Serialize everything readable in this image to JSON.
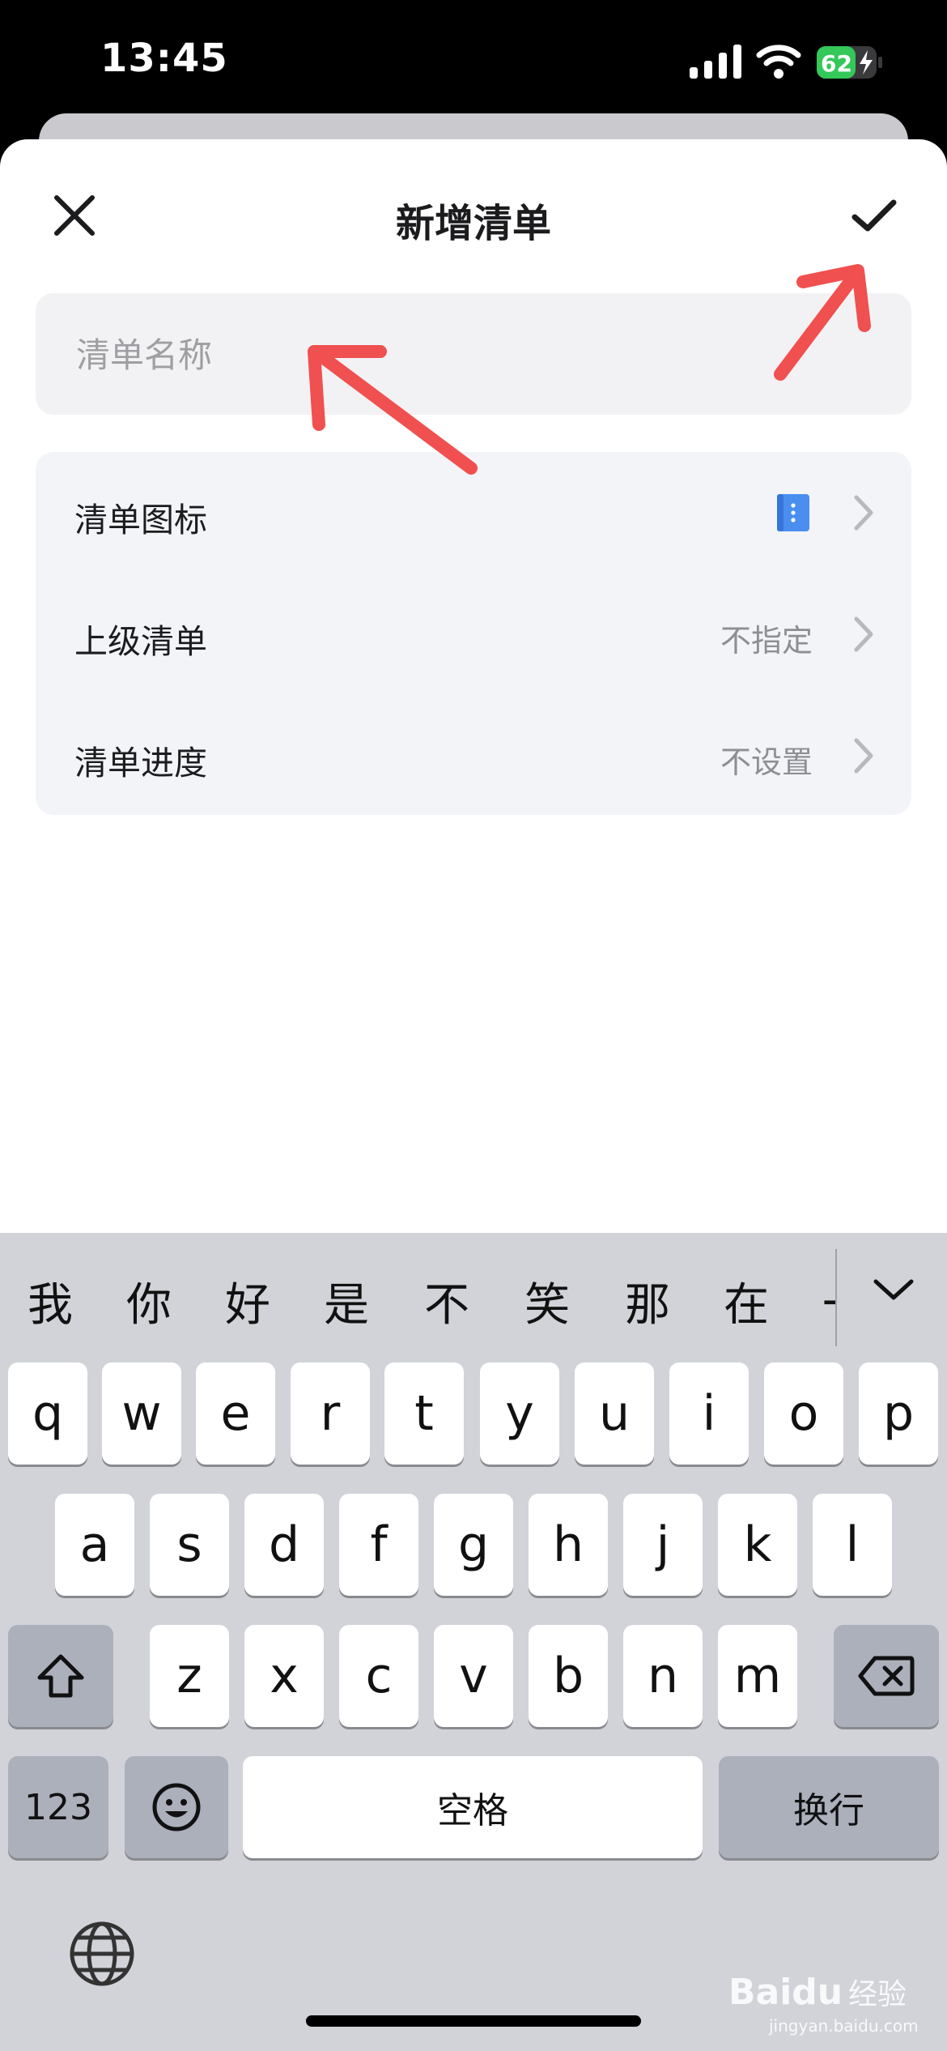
{
  "status_bar": {
    "time": "13:45",
    "battery_level": "62"
  },
  "sheet": {
    "title": "新增清单",
    "name_field": {
      "placeholder": "清单名称",
      "value": ""
    },
    "options": [
      {
        "label": "清单图标",
        "value": "",
        "icon": "blue-list-icon"
      },
      {
        "label": "上级清单",
        "value": "不指定"
      },
      {
        "label": "清单进度",
        "value": "不设置"
      }
    ]
  },
  "keyboard": {
    "candidates": [
      "我",
      "你",
      "好",
      "是",
      "不",
      "笑",
      "那",
      "在",
      "一"
    ],
    "row1": [
      "q",
      "w",
      "e",
      "r",
      "t",
      "y",
      "u",
      "i",
      "o",
      "p"
    ],
    "row2": [
      "a",
      "s",
      "d",
      "f",
      "g",
      "h",
      "j",
      "k",
      "l"
    ],
    "row3": [
      "z",
      "x",
      "c",
      "v",
      "b",
      "n",
      "m"
    ],
    "numbers_key": "123",
    "space_key": "空格",
    "return_key": "换行"
  },
  "watermark": {
    "brand": "Baidu",
    "product": "经验",
    "url": "jingyan.baidu.com"
  },
  "colors": {
    "annotation_arrow": "#f0504f",
    "accent_blue": "#4a8ef0",
    "sheet_background": "#ffffff",
    "card_background": "#f2f4f8"
  }
}
